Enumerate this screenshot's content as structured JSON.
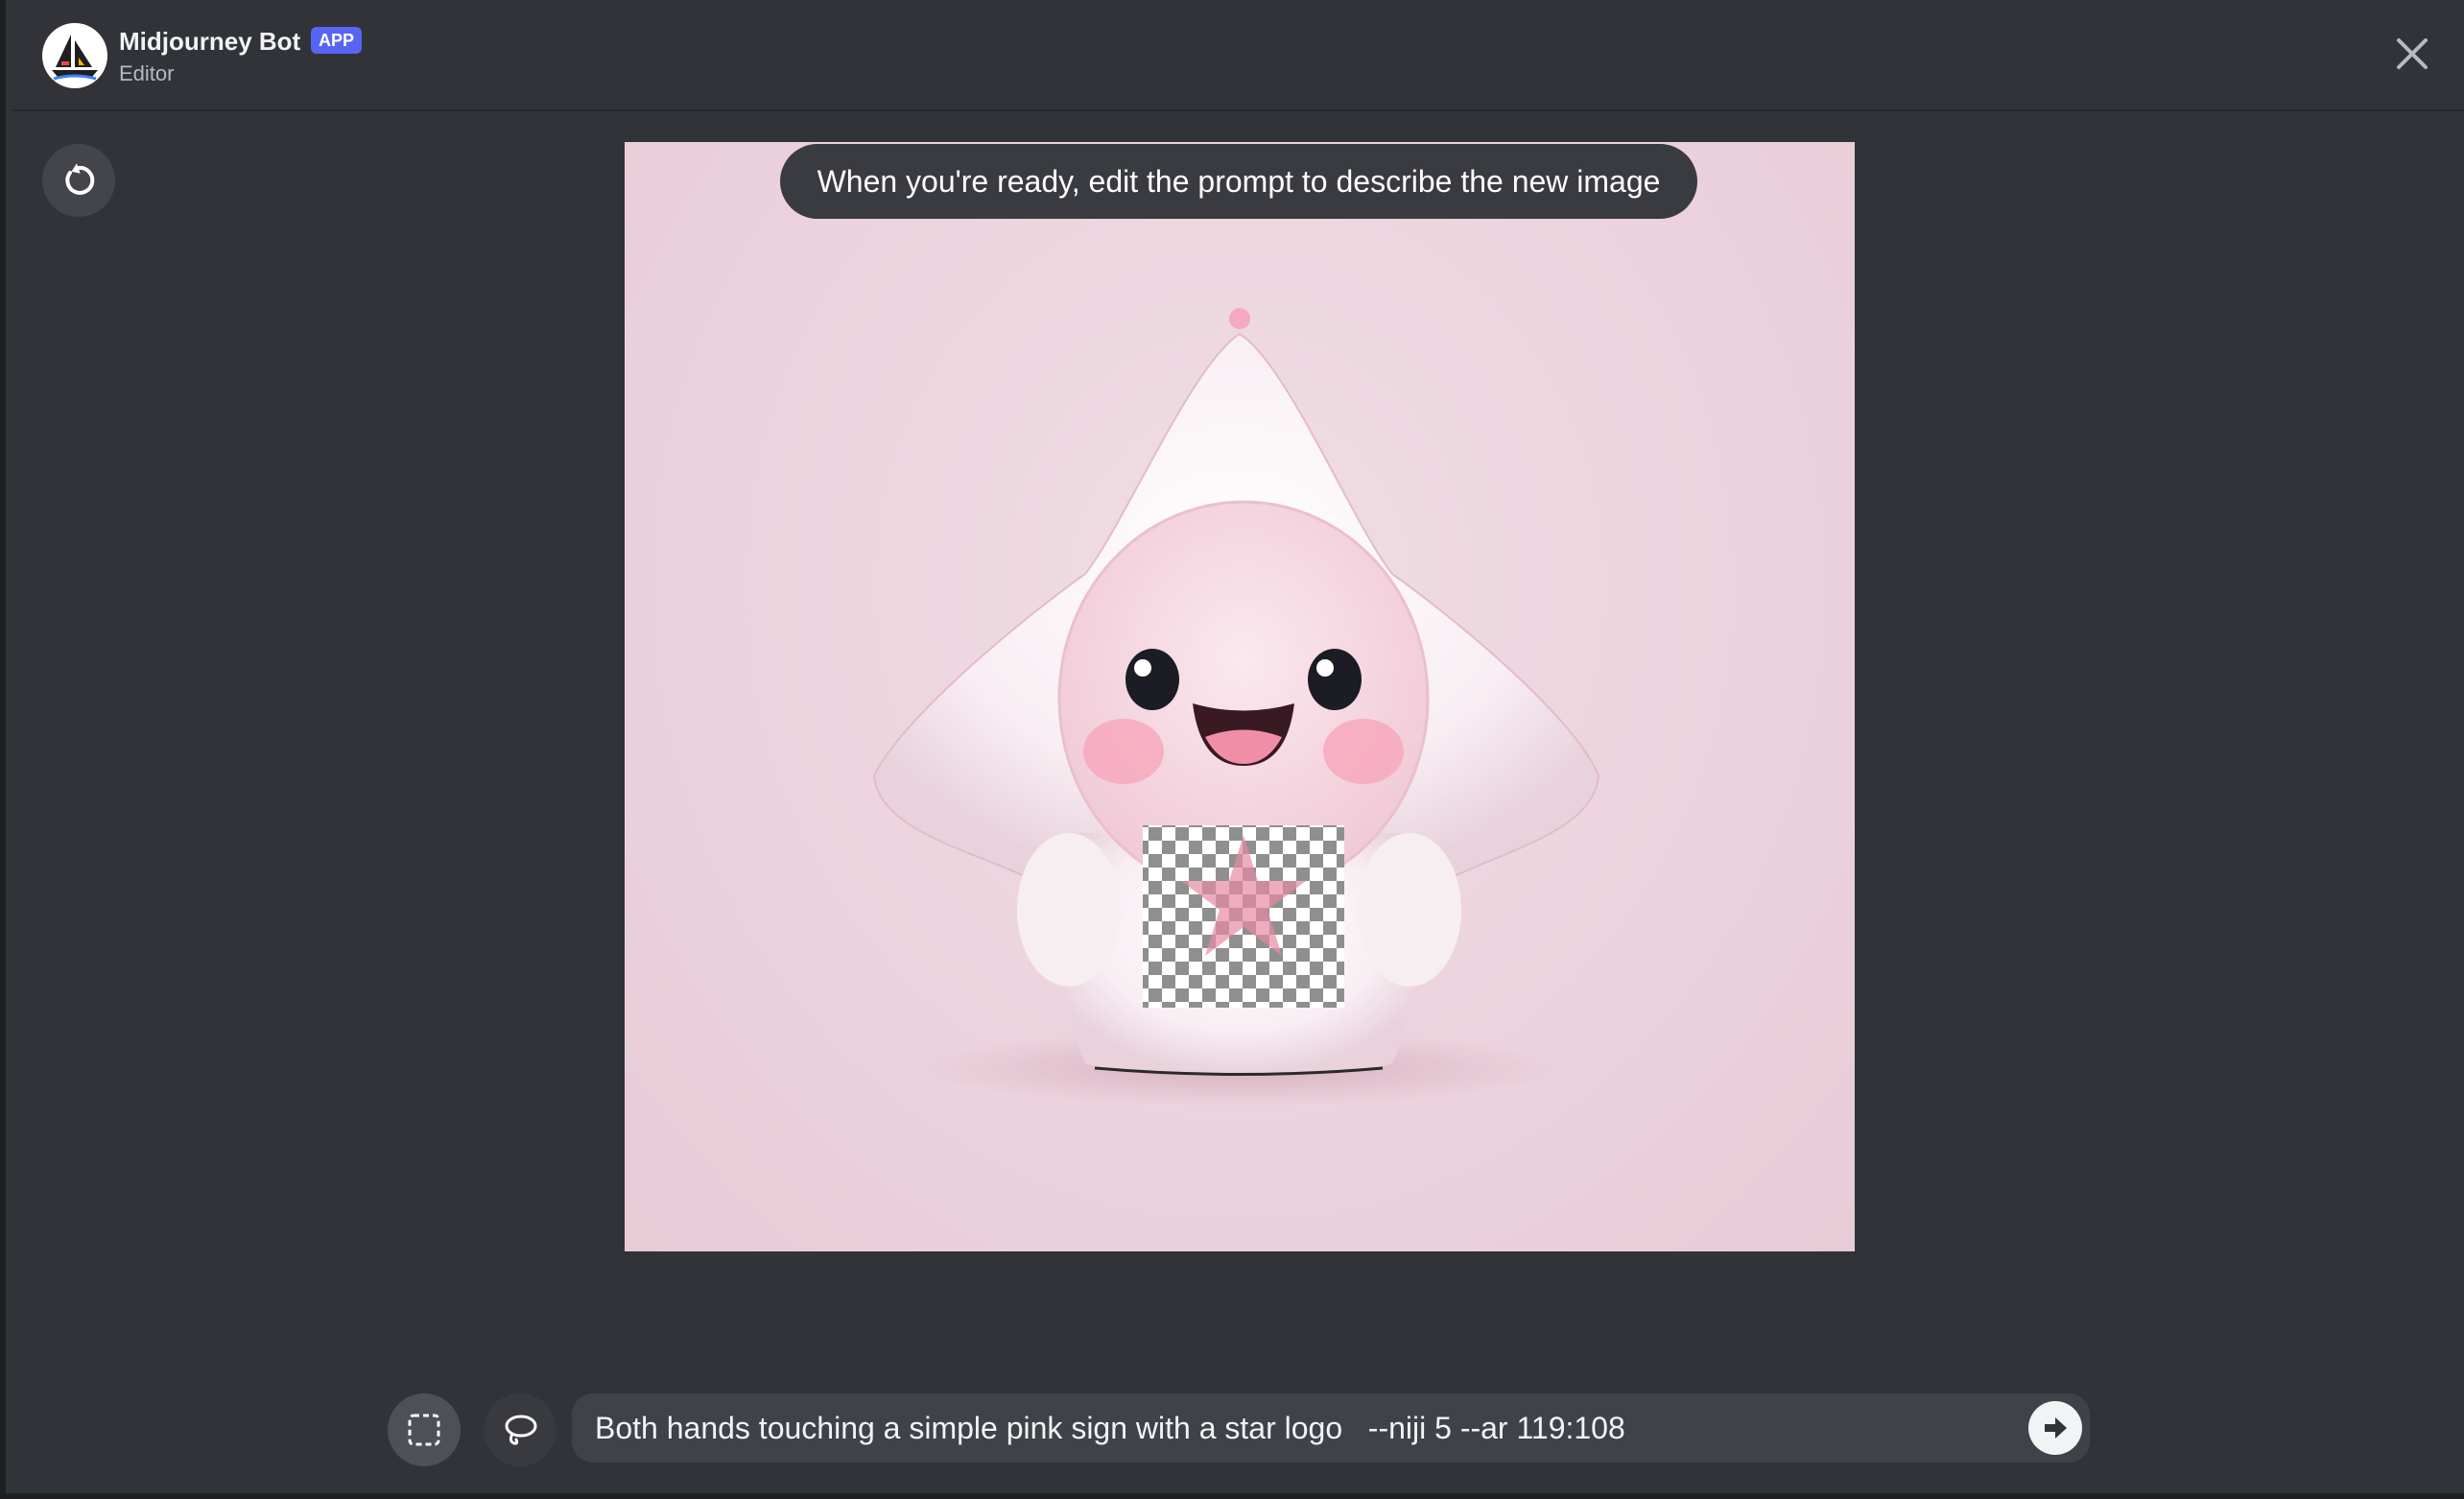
{
  "header": {
    "bot_name": "Midjourney Bot",
    "badge": "APP",
    "subtitle": "Editor",
    "avatar_icon": "sailboat-icon",
    "close_icon": "close-icon"
  },
  "toolbar": {
    "undo_icon": "undo-icon",
    "rectangle_tool_icon": "rectangle-select-icon",
    "lasso_tool_icon": "lasso-icon"
  },
  "canvas": {
    "tooltip": "When you're ready, edit the prompt to describe the new image"
  },
  "prompt": {
    "value": "Both hands touching a simple pink sign with a star logo   --niji 5 --ar 119:108",
    "send_icon": "send-arrow-icon"
  },
  "colors": {
    "background": "#313338",
    "badge": "#5865f2",
    "input": "#404249",
    "canvas_pink": "#ecd3dd"
  }
}
